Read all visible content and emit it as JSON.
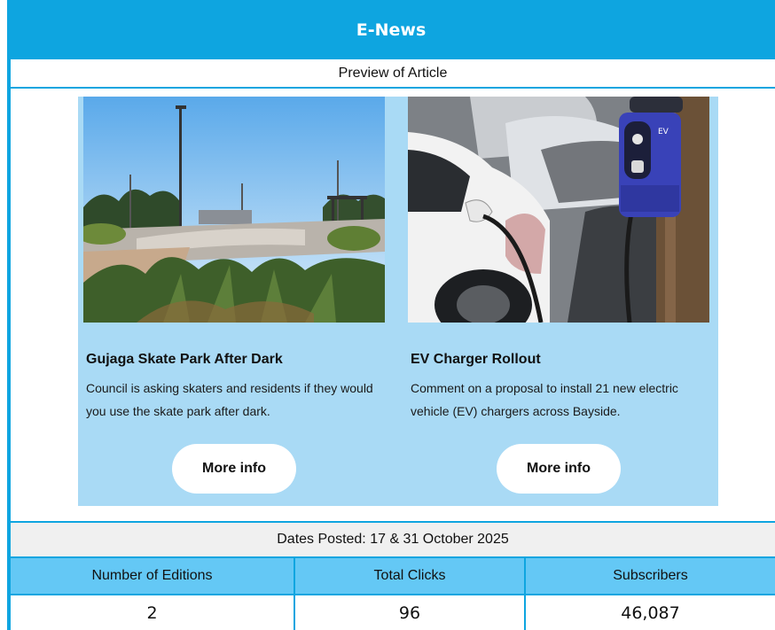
{
  "header": {
    "title": "E-News"
  },
  "preview": {
    "label": "Preview of Article"
  },
  "articles": [
    {
      "title": "Gujaga Skate Park After Dark",
      "description": "Council is asking skaters and residents if they would you use the skate park after dark.",
      "button_label": "More info",
      "image_icon": "skate-park-photo"
    },
    {
      "title": "EV Charger Rollout",
      "description": "Comment on a proposal to install 21 new electric vehicle (EV) chargers across Bayside.",
      "button_label": "More info",
      "image_icon": "ev-charger-photo"
    }
  ],
  "dates": {
    "text": "Dates Posted: 17 & 31 October 2025"
  },
  "stats": {
    "headers": [
      "Number of Editions",
      "Total Clicks",
      "Subscribers"
    ],
    "values": [
      "2",
      "96",
      "46,087"
    ]
  },
  "colors": {
    "accent": "#0ea5e0",
    "card_bg": "#a9daf5",
    "stats_header_bg": "#64c8f5",
    "dates_bg": "#f0f0f0"
  }
}
